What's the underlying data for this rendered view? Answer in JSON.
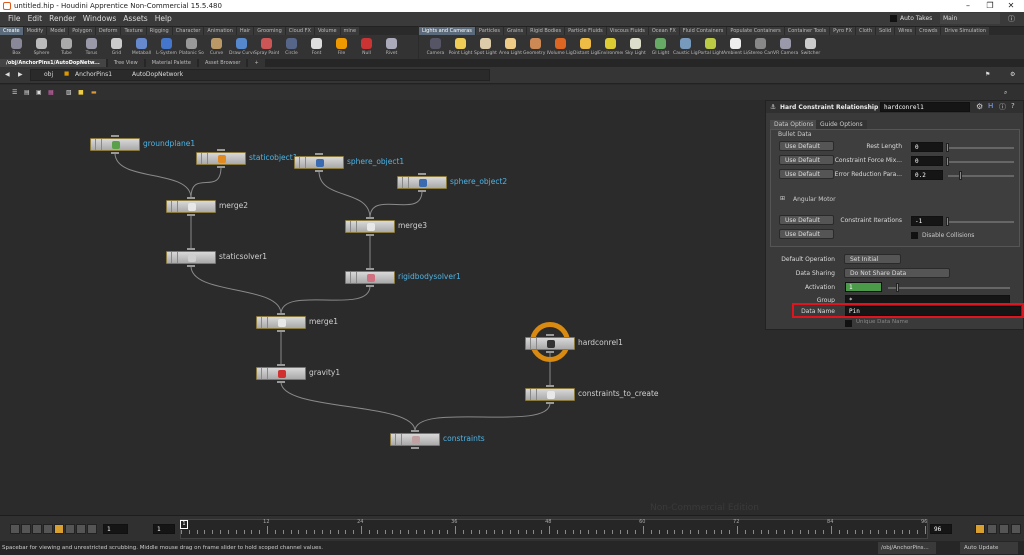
{
  "window": {
    "title": "untitled.hip - Houdini Apprentice Non-Commercial 15.5.480",
    "minimize": "–",
    "maximize": "❐",
    "close": "✕"
  },
  "menu": [
    "File",
    "Edit",
    "Render",
    "Windows",
    "Assets",
    "Help"
  ],
  "top_right": {
    "auto_takes": "Auto Takes",
    "desktop": "Main"
  },
  "shelf_left": {
    "tabs": [
      "Create",
      "Modify",
      "Model",
      "Polygon",
      "Deform",
      "Texture",
      "Rigging",
      "Character",
      "Animation",
      "Hair",
      "Grooming",
      "Cloud FX",
      "Volume",
      "mine"
    ],
    "tools": [
      "Box",
      "Sphere",
      "Tube",
      "Torus",
      "Grid",
      "Metaball",
      "L-System",
      "Platonic Sol...",
      "Curve",
      "Draw Curve",
      "Spray Paint",
      "Circle",
      "Font",
      "File",
      "Null",
      "Rivet"
    ]
  },
  "shelf_right": {
    "tabs": [
      "Lights and Cameras",
      "Particles",
      "Grains",
      "Rigid Bodies",
      "Particle Fluids",
      "Viscous Fluids",
      "Ocean FX",
      "Fluid Containers",
      "Populate Containers",
      "Container Tools",
      "Pyro FX",
      "Cloth",
      "Solid",
      "Wires",
      "Crowds",
      "Drive Simulation"
    ],
    "tools": [
      "Camera",
      "Point Light",
      "Spot Light",
      "Area Light",
      "Geometry L...",
      "Volume Light",
      "Distant Light",
      "Environmen...",
      "Sky Light",
      "GI Light",
      "Caustic Light",
      "Portal Light",
      "Ambient Lig...",
      "Stereo Cam...",
      "VR Camera",
      "Switcher"
    ]
  },
  "pane_tabs": [
    "/obj/AnchorPins1/AutoDopNetw...",
    "Tree View",
    "Material Palette",
    "Asset Browser"
  ],
  "path": [
    "obj",
    "AnchorPins1",
    "AutoDopNetwork"
  ],
  "nodes": [
    {
      "name": "groundplane1",
      "label_color": "#4fb4e6",
      "icon_color": "#5aa04a"
    },
    {
      "name": "staticobject1",
      "label_color": "#4fb4e6",
      "icon_color": "#e08a20"
    },
    {
      "name": "sphere_object1",
      "label_color": "#4fb4e6",
      "icon_color": "#3a6ab0"
    },
    {
      "name": "sphere_object2",
      "label_color": "#4fb4e6",
      "icon_color": "#3a6ab0"
    },
    {
      "name": "merge2",
      "label_color": "#d0d0d0",
      "icon_color": "#e8e8e8"
    },
    {
      "name": "merge3",
      "label_color": "#d0d0d0",
      "icon_color": "#e8e8e8"
    },
    {
      "name": "staticsolver1",
      "label_color": "#d0d0d0",
      "icon_color": "#cfcfcf"
    },
    {
      "name": "rigidbodysolver1",
      "label_color": "#4fb4e6",
      "icon_color": "#d07080"
    },
    {
      "name": "merge1",
      "label_color": "#d0d0d0",
      "icon_color": "#e8e8e8"
    },
    {
      "name": "gravity1",
      "label_color": "#d0d0d0",
      "icon_color": "#d03030"
    },
    {
      "name": "constraints",
      "label_color": "#4fb4e6",
      "icon_color": "#c0a0a0"
    },
    {
      "name": "hardconrel1",
      "label_color": "#d0d0d0",
      "icon_color": "#333333"
    },
    {
      "name": "constraints_to_create",
      "label_color": "#d0d0d0",
      "icon_color": "#e8e8e8"
    }
  ],
  "params": {
    "node_type": "Hard Constraint Relationship",
    "node_name": "hardconrel1",
    "tabs": [
      "Data Options",
      "Guide Options"
    ],
    "group": "Bullet Data",
    "use_default": "Use Default",
    "rest_length": {
      "label": "Rest Length",
      "value": "0"
    },
    "cfm": {
      "label": "Constraint Force Mix...",
      "value": "0"
    },
    "erp": {
      "label": "Error Reduction Para...",
      "value": "0.2"
    },
    "angular_motor": "Angular Motor",
    "iterations": {
      "label": "Constraint Iterations",
      "value": "-1"
    },
    "disable_collisions": "Disable Collisions",
    "default_operation": {
      "label": "Default Operation",
      "value": "Set Initial"
    },
    "data_sharing": {
      "label": "Data Sharing",
      "value": "Do Not Share Data"
    },
    "activation": {
      "label": "Activation",
      "value": "1"
    },
    "group_field": {
      "label": "Group",
      "value": "*"
    },
    "data_name": {
      "label": "Data Name",
      "value": "Pin"
    },
    "unique": "Unique Data Name",
    "highlight_color": "#e0141e"
  },
  "watermark": "Non-Commercial Edition",
  "timeline": {
    "frame": "1",
    "start": "1",
    "current": "1",
    "ticks": [
      "12",
      "24",
      "36",
      "48",
      "60",
      "72",
      "84",
      "96"
    ],
    "end": "96"
  },
  "status": {
    "message": "Spacebar for viewing and unrestricted scrubbing. Middle mouse drag on frame slider to hold scoped channel values.",
    "path": "/obj/AnchorPins...",
    "update": "Auto Update"
  }
}
